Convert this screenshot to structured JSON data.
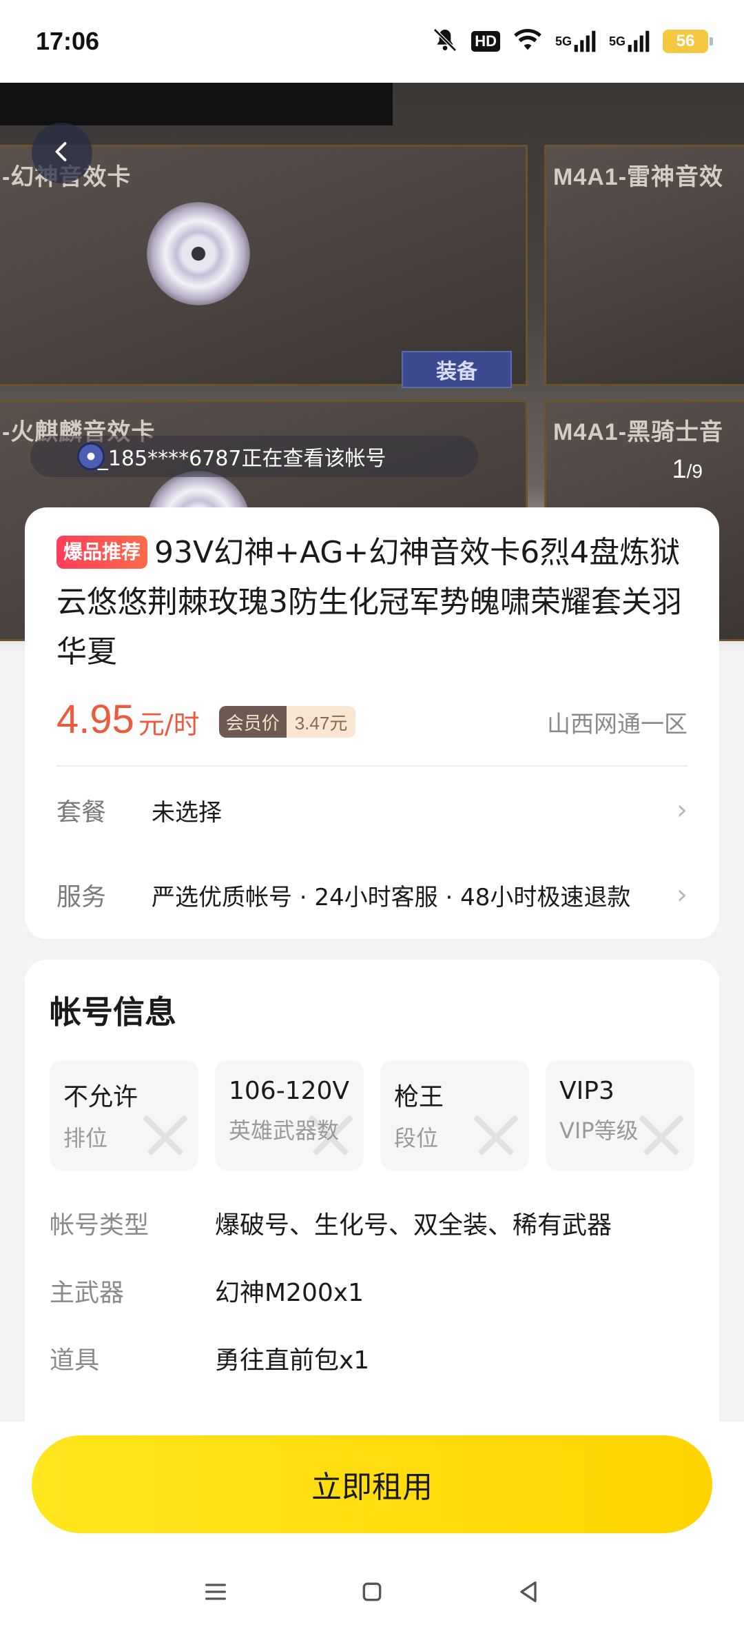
{
  "status_bar": {
    "time": "17:06",
    "hd_label": "HD",
    "net1": "5G",
    "net2": "5G",
    "battery": "56"
  },
  "hero": {
    "card_labels": [
      "-幻神音效卡",
      "M4A1-雷神音效",
      "-火麒麟音效卡",
      "M4A1-黑骑士音"
    ],
    "equip_label": "装备",
    "viewer_text": "SJ_185****6787正在查看该帐号",
    "image_index": "1",
    "image_total": "/9"
  },
  "product": {
    "tag": "爆品推荐",
    "title": "93V幻神+AG+幻神音效卡6烈4盘炼狱云悠悠荆棘玫瑰3防生化冠军势魄啸荣耀套关羽华夏",
    "price": "4.95",
    "price_unit": "元/时",
    "member_label": "会员价",
    "member_price": "3.47元",
    "region": "山西网通一区",
    "options": [
      {
        "label": "套餐",
        "value": "未选择"
      },
      {
        "label": "服务",
        "value": "严选优质帐号 · 24小时客服 · 48小时极速退款"
      }
    ]
  },
  "account_info": {
    "title": "帐号信息",
    "tiles": [
      {
        "value": "不允许",
        "label": "排位"
      },
      {
        "value": "106-120V",
        "label": "英雄武器数"
      },
      {
        "value": "枪王",
        "label": "段位"
      },
      {
        "value": "VIP3",
        "label": "VIP等级"
      }
    ],
    "details": [
      {
        "key": "帐号类型",
        "value": "爆破号、生化号、双全装、稀有武器"
      },
      {
        "key": "主武器",
        "value": "幻神M200x1"
      },
      {
        "key": "道具",
        "value": "勇往直前包x1"
      }
    ]
  },
  "bottom": {
    "rent_button": "立即租用"
  },
  "colors": {
    "price": "#ef5a3c",
    "button": "#ffd400",
    "hot_tag": "#ff3d5a"
  }
}
